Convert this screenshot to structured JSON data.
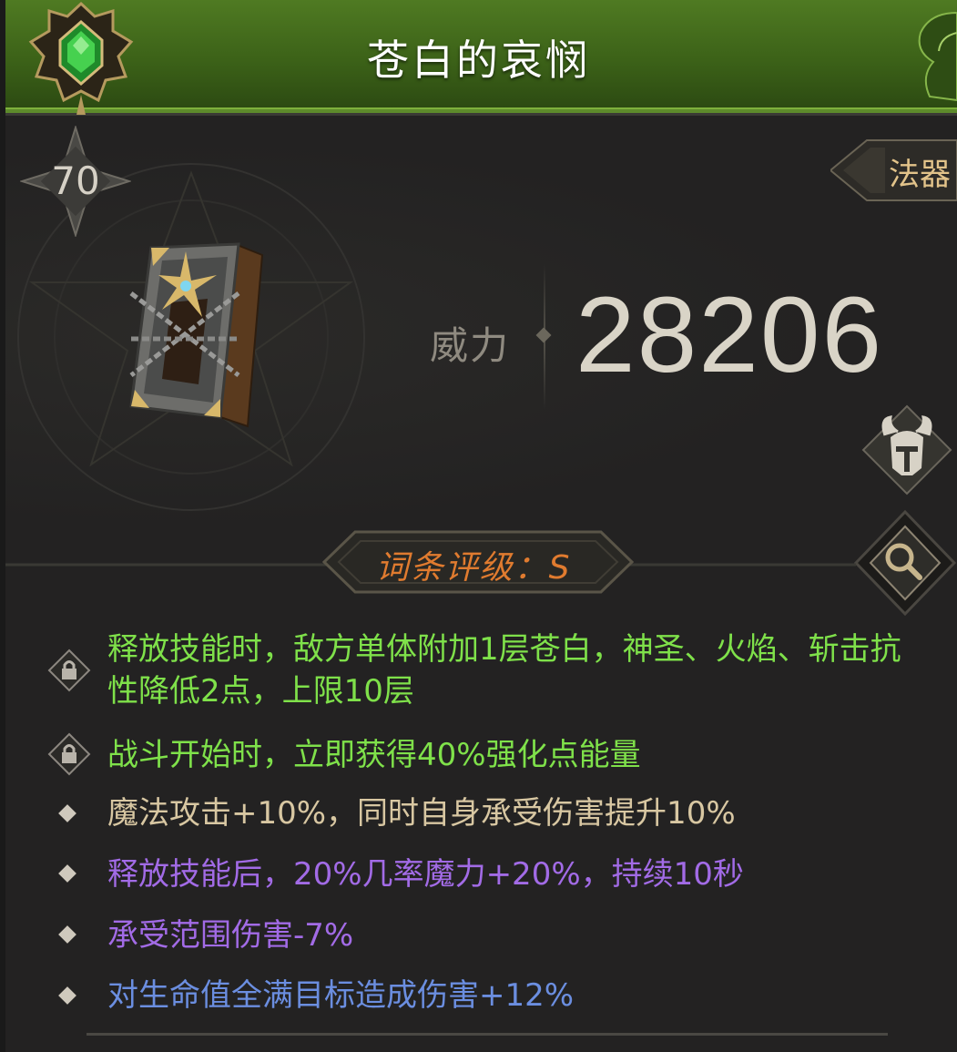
{
  "item": {
    "name": "苍白的哀悯",
    "level": "70",
    "category": "法器",
    "power_label": "威力",
    "power_value": "28206",
    "rating_text": "词条评级：S"
  },
  "affixes": [
    {
      "text": "释放技能时，敌方单体附加1层苍白，神圣、火焰、斩击抗性降低2点，上限10层",
      "color": "#7fe14a",
      "marker": "lock-icon"
    },
    {
      "text": "战斗开始时，立即获得40%强化点能量",
      "color": "#7fe14a",
      "marker": "lock-icon"
    },
    {
      "text": "魔法攻击+10%，同时自身承受伤害提升10%",
      "color": "#d8c7a2",
      "marker": "diamond-bullet-icon"
    },
    {
      "text": "释放技能后，20%几率魔力+20%，持续10秒",
      "color": "#a26be6",
      "marker": "diamond-bullet-icon"
    },
    {
      "text": "承受范围伤害-7%",
      "color": "#a26be6",
      "marker": "diamond-bullet-icon"
    },
    {
      "text": "对生命值全满目标造成伤害+12%",
      "color": "#6b8ee0",
      "marker": "diamond-bullet-icon"
    }
  ],
  "icons": {
    "emblem": "green-gem-emblem-icon",
    "item_image": "chained-book-icon",
    "helmet": "horned-helmet-icon",
    "search": "magnifier-icon"
  }
}
